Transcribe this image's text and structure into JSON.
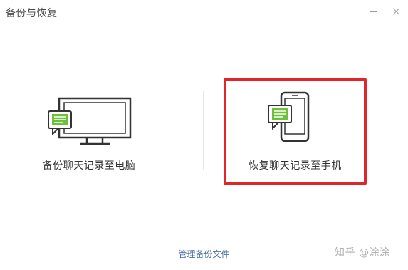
{
  "window": {
    "title": "备份与恢复",
    "minimize_label": "",
    "close_label": ""
  },
  "options": {
    "backup_to_pc": {
      "label": "备份聊天记录至电脑",
      "icon": "monitor-chat-icon"
    },
    "restore_to_phone": {
      "label": "恢复聊天记录至手机",
      "icon": "phone-chat-icon",
      "highlighted": true
    }
  },
  "footer": {
    "manage_link": "管理备份文件"
  },
  "watermark": {
    "text": "知乎 @涂涂"
  },
  "colors": {
    "highlight": "#e0262a",
    "chat_bubble": "#6fbf3a",
    "icon_stroke": "#333333",
    "link": "#4a6ea8"
  }
}
